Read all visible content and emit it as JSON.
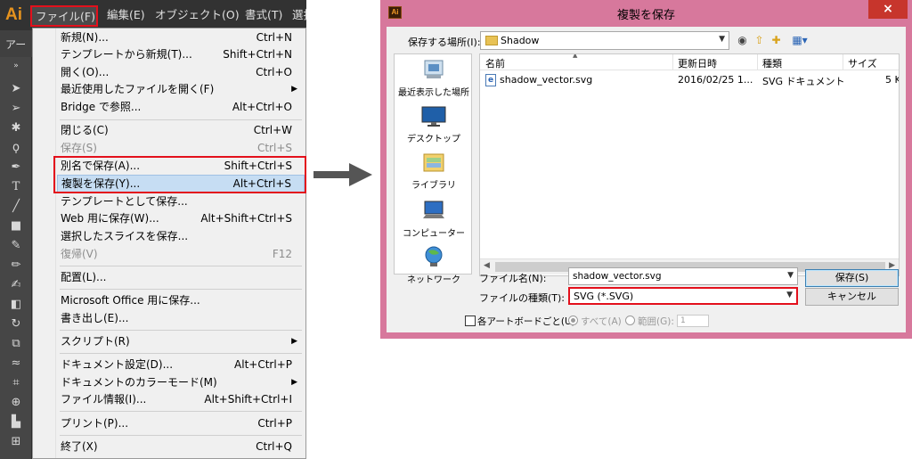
{
  "illustrator": {
    "logo": "Ai",
    "menubar": [
      "ファイル(F)",
      "編集(E)",
      "オブジェクト(O)",
      "書式(T)",
      "選択"
    ],
    "panel_tab": "アー",
    "menu_items": [
      {
        "label": "新規(N)...",
        "shortcut": "Ctrl+N"
      },
      {
        "label": "テンプレートから新規(T)...",
        "shortcut": "Shift+Ctrl+N"
      },
      {
        "label": "開く(O)...",
        "shortcut": "Ctrl+O"
      },
      {
        "label": "最近使用したファイルを開く(F)",
        "submenu": true
      },
      {
        "label": "Bridge で参照...",
        "shortcut": "Alt+Ctrl+O"
      },
      {
        "label": "閉じる(C)",
        "shortcut": "Ctrl+W"
      },
      {
        "label": "保存(S)",
        "shortcut": "Ctrl+S",
        "disabled": true
      },
      {
        "label": "別名で保存(A)...",
        "shortcut": "Shift+Ctrl+S"
      },
      {
        "label": "複製を保存(Y)...",
        "shortcut": "Alt+Ctrl+S",
        "highlighted": true
      },
      {
        "label": "テンプレートとして保存..."
      },
      {
        "label": "Web 用に保存(W)...",
        "shortcut": "Alt+Shift+Ctrl+S"
      },
      {
        "label": "選択したスライスを保存..."
      },
      {
        "label": "復帰(V)",
        "shortcut": "F12",
        "disabled": true
      },
      {
        "label": "配置(L)..."
      },
      {
        "label": "Microsoft Office 用に保存..."
      },
      {
        "label": "書き出し(E)..."
      },
      {
        "label": "スクリプト(R)",
        "submenu": true
      },
      {
        "label": "ドキュメント設定(D)...",
        "shortcut": "Alt+Ctrl+P"
      },
      {
        "label": "ドキュメントのカラーモード(M)",
        "submenu": true
      },
      {
        "label": "ファイル情報(I)...",
        "shortcut": "Alt+Shift+Ctrl+I"
      },
      {
        "label": "プリント(P)...",
        "shortcut": "Ctrl+P"
      },
      {
        "label": "終了(X)",
        "shortcut": "Ctrl+Q"
      }
    ]
  },
  "dialog": {
    "title": "複製を保存",
    "app_icon": "Ai",
    "close": "×",
    "save_in_label": "保存する場所(I):",
    "save_in_value": "Shadow",
    "places": [
      "最近表示した場所",
      "デスクトップ",
      "ライブラリ",
      "コンピューター",
      "ネットワーク"
    ],
    "columns": [
      "名前",
      "更新日時",
      "種類",
      "サイズ"
    ],
    "files": [
      {
        "name": "shadow_vector.svg",
        "date": "2016/02/25 1...",
        "type": "SVG ドキュメント",
        "size": "5 K"
      }
    ],
    "filename_label": "ファイル名(N):",
    "filename_value": "shadow_vector.svg",
    "filetype_label": "ファイルの種類(T):",
    "filetype_value": "SVG (*.SVG)",
    "save_button": "保存(S)",
    "cancel_button": "キャンセル",
    "artboard_option": "各アートボードごと(U)",
    "all_option": "すべて(A)",
    "range_option": "範囲(G):",
    "range_value": "1"
  },
  "colors": {
    "highlight_red": "#e3101c",
    "dialog_frame": "#d7789c",
    "menu_highlight": "#c6ddf3"
  }
}
